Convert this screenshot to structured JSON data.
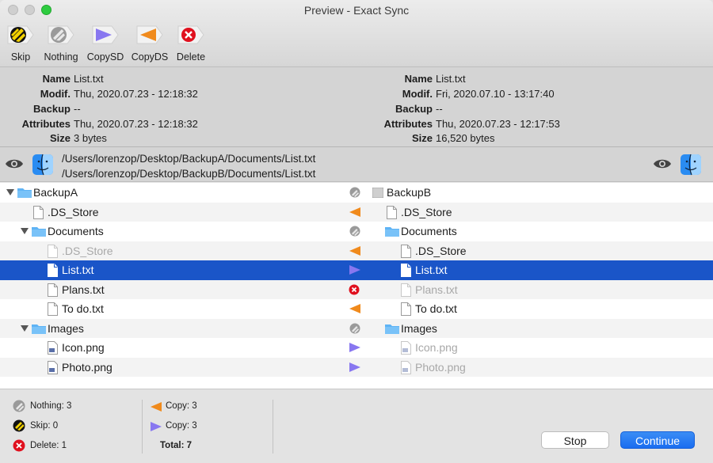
{
  "window": {
    "title": "Preview - Exact Sync"
  },
  "toolbar": {
    "skip": "Skip",
    "nothing": "Nothing",
    "copysd": "CopySD",
    "copyds": "CopyDS",
    "delete": "Delete"
  },
  "info": {
    "left": {
      "name_k": "Name",
      "name": "List.txt",
      "modif_k": "Modif.",
      "modif": "Thu, 2020.07.23 - 12:18:32",
      "backup_k": "Backup",
      "backup": "--",
      "attr_k": "Attributes",
      "attr": "Thu, 2020.07.23 - 12:18:32",
      "size_k": "Size",
      "size": "3 bytes"
    },
    "right": {
      "name_k": "Name",
      "name": "List.txt",
      "modif_k": "Modif.",
      "modif": "Fri, 2020.07.10 - 13:17:40",
      "backup_k": "Backup",
      "backup": "--",
      "attr_k": "Attributes",
      "attr": "Thu, 2020.07.23 - 12:17:53",
      "size_k": "Size",
      "size": "16,520 bytes"
    }
  },
  "paths": {
    "source": "/Users/lorenzop/Desktop/BackupA/Documents/List.txt",
    "dest": "/Users/lorenzop/Desktop/BackupB/Documents/List.txt"
  },
  "tree": [
    {
      "left": "BackupA",
      "right": "BackupB",
      "action": "nothing"
    },
    {
      "left": ".DS_Store",
      "right": ".DS_Store",
      "action": "copyds"
    },
    {
      "left": "Documents",
      "right": "Documents",
      "action": "nothing"
    },
    {
      "left": ".DS_Store",
      "right": ".DS_Store",
      "action": "copyds"
    },
    {
      "left": "List.txt",
      "right": "List.txt",
      "action": "copysd"
    },
    {
      "left": "Plans.txt",
      "right": "Plans.txt",
      "action": "delete"
    },
    {
      "left": "To do.txt",
      "right": "To do.txt",
      "action": "copyds"
    },
    {
      "left": "Images",
      "right": "Images",
      "action": "nothing"
    },
    {
      "left": "Icon.png",
      "right": "Icon.png",
      "action": "copysd"
    },
    {
      "left": "Photo.png",
      "right": "Photo.png",
      "action": "copysd"
    }
  ],
  "stats": {
    "nothing": "Nothing: 3",
    "skip": "Skip: 0",
    "delete": "Delete: 1",
    "copy_ds": "Copy: 3",
    "copy_sd": "Copy: 3",
    "total": "Total: 7"
  },
  "buttons": {
    "stop": "Stop",
    "continue": "Continue"
  },
  "colors": {
    "accent": "#1a55c8",
    "copysd": "#8877f0",
    "copyds": "#f08a1c",
    "delete": "#e0101e",
    "skip": "#f2d100"
  }
}
